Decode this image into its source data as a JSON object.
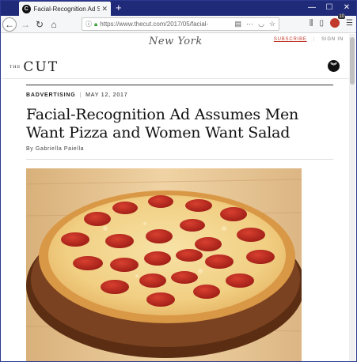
{
  "browser": {
    "tab_title": "Facial-Recognition Ad Shows M",
    "tab_favicon_letter": "C",
    "url": "https://www.thecut.com/2017/05/facial-",
    "extension_badge_count": "10"
  },
  "site": {
    "network_logo": "New York",
    "subscribe": "SUBSCRIBE",
    "sign_in": "SIGN IN",
    "brand_the": "THE",
    "brand_name": "CUT"
  },
  "article": {
    "kicker": "BADVERTISING",
    "date": "MAY 12, 2017",
    "headline": "Facial-Recognition Ad Assumes Men Want Pizza and Women Want Salad",
    "byline": "By Gabriella Paiella"
  },
  "colors": {
    "tab_strip": "#1f2a78",
    "accent": "#c0392b",
    "pepperoni": "#b8261e",
    "wood": "#6b3a1c"
  }
}
